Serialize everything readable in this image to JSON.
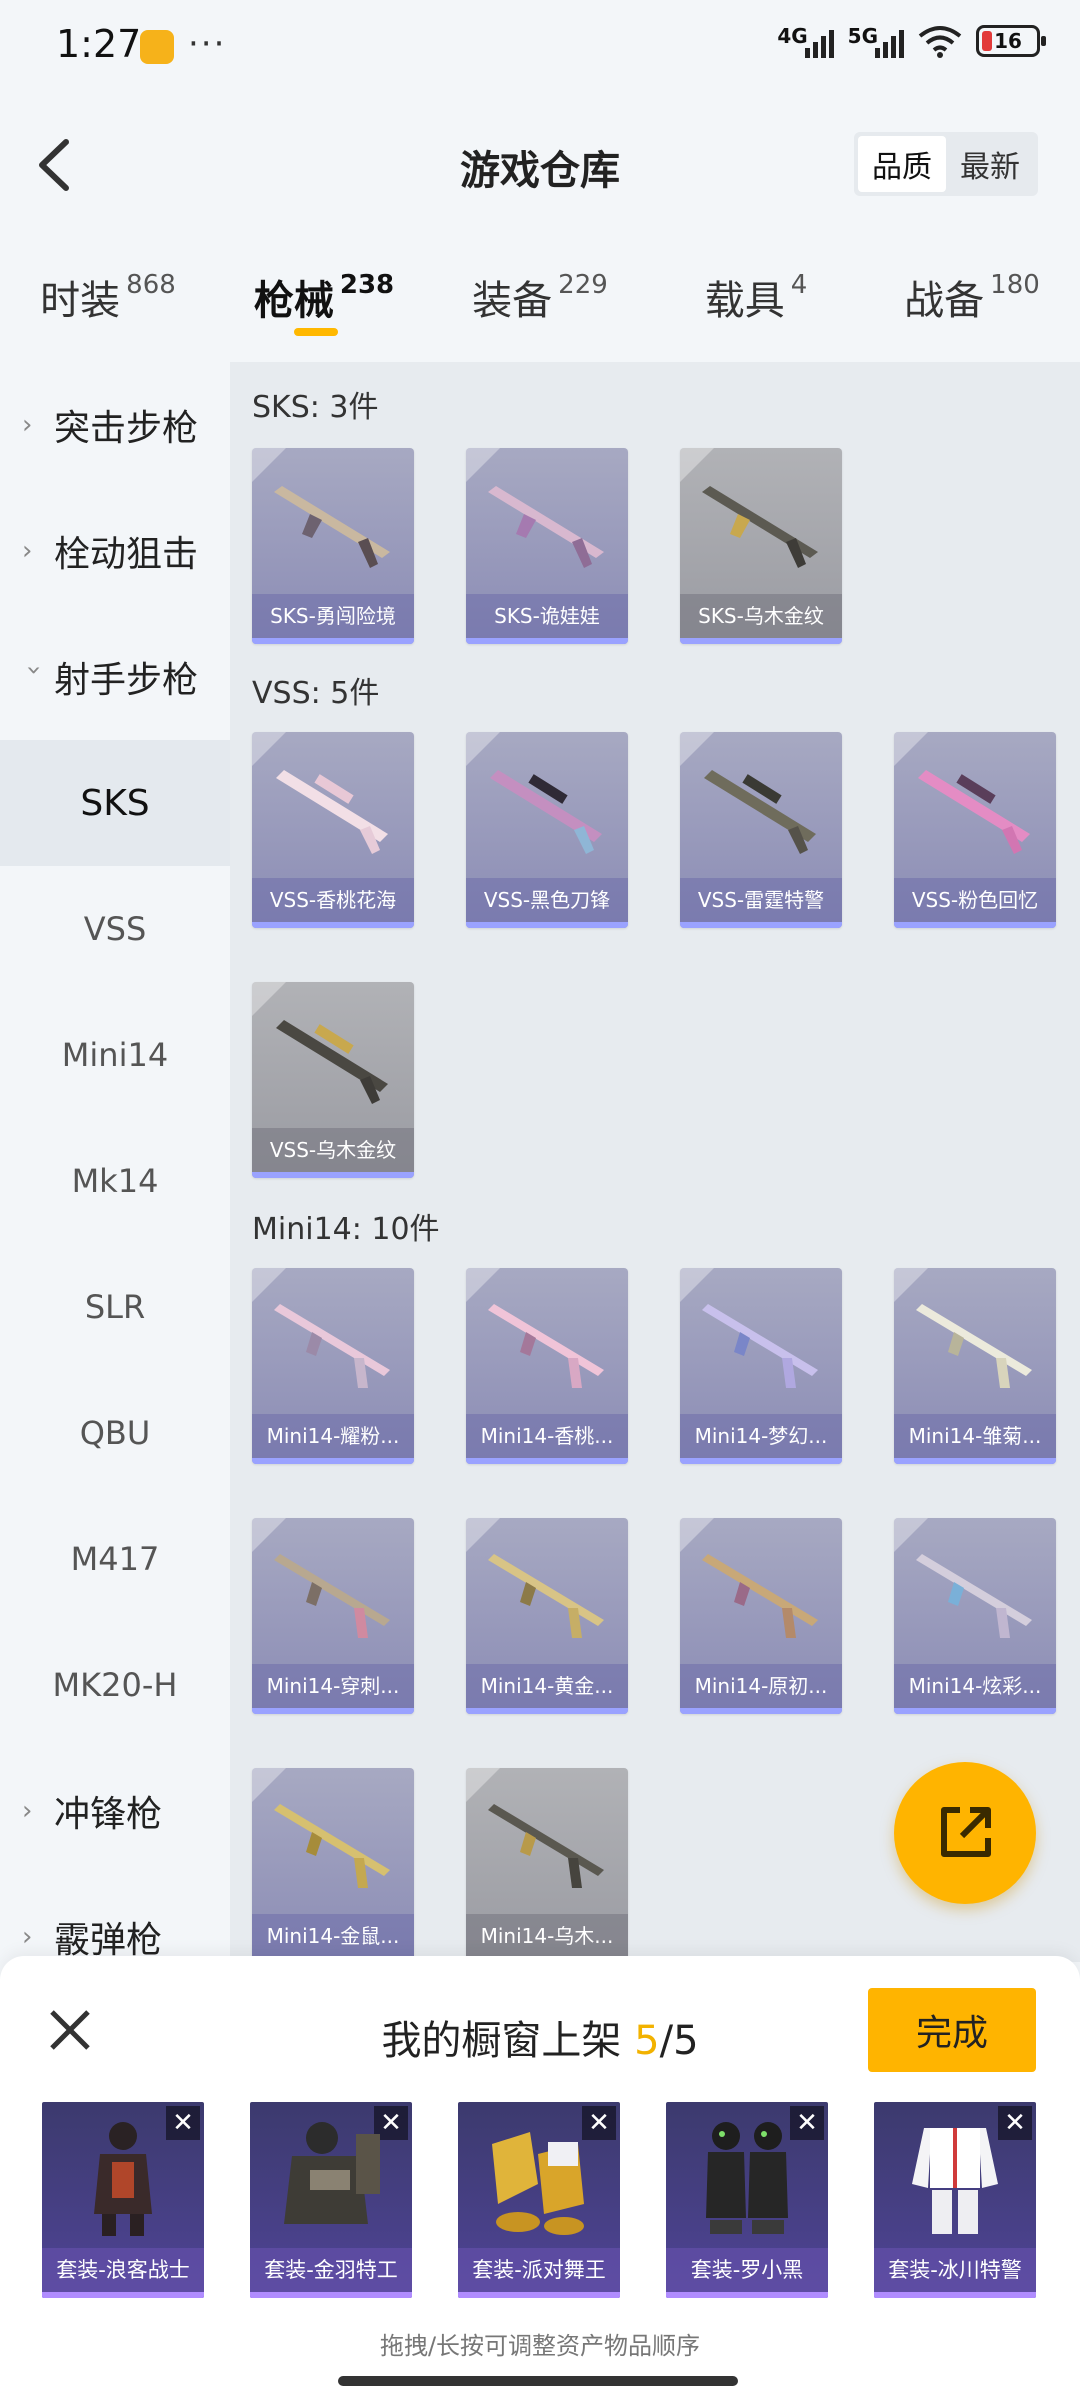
{
  "status_bar": {
    "time": "1:27",
    "more": "···",
    "net1": "4G",
    "net2": "5G",
    "battery": "16"
  },
  "header": {
    "title": "游戏仓库",
    "sort": [
      "品质",
      "最新"
    ]
  },
  "tabs": [
    {
      "label": "时装",
      "count": "868"
    },
    {
      "label": "枪械",
      "count": "238",
      "active": true
    },
    {
      "label": "装备",
      "count": "229"
    },
    {
      "label": "载具",
      "count": "4"
    },
    {
      "label": "战备",
      "count": "180"
    }
  ],
  "sidebar": {
    "groups": [
      "突击步枪",
      "栓动狙击",
      "射手步枪",
      "冲锋枪",
      "霰弹枪"
    ],
    "items": [
      "SKS",
      "VSS",
      "Mini14",
      "Mk14",
      "SLR",
      "QBU",
      "M417",
      "MK20-H"
    ]
  },
  "sections": [
    {
      "title": "SKS: 3件",
      "items": [
        "SKS-勇闯险境",
        "SKS-诡娃娃",
        "SKS-乌木金纹"
      ]
    },
    {
      "title": "VSS: 5件",
      "items": [
        "VSS-香桃花海",
        "VSS-黑色刀锋",
        "VSS-雷霆特警",
        "VSS-粉色回忆",
        "VSS-乌木金纹"
      ]
    },
    {
      "title": "Mini14: 10件",
      "items": [
        "Mini14-耀粉...",
        "Mini14-香桃...",
        "Mini14-梦幻...",
        "Mini14-雏菊...",
        "Mini14-穿刺...",
        "Mini14-黄金...",
        "Mini14-原初...",
        "Mini14-炫彩...",
        "Mini14-金鼠...",
        "Mini14-乌木..."
      ]
    }
  ],
  "sheet": {
    "title_prefix": "我的橱窗上架",
    "current": "5",
    "slash": "/",
    "max": "5",
    "done_label": "完成",
    "outfits": [
      "套装-浪客战士",
      "套装-金羽特工",
      "套装-派对舞王",
      "套装-罗小黑",
      "套装-冰川特警"
    ],
    "hint": "拖拽/长按可调整资产物品顺序"
  },
  "colors": {
    "accent": "#ffb400",
    "card": "#8b8cb5",
    "outfit": "#4f4496"
  }
}
